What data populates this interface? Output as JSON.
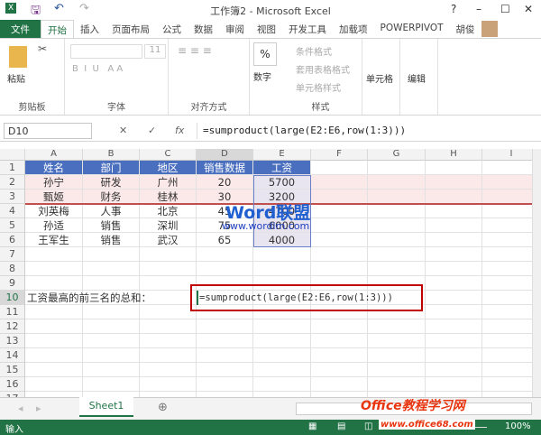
{
  "title": "工作簿2 - Microsoft Excel",
  "user": "胡俊",
  "tabs": [
    "文件",
    "开始",
    "插入",
    "页面布局",
    "公式",
    "数据",
    "审阅",
    "视图",
    "开发工具",
    "加载项",
    "POWERPIVOT"
  ],
  "ribbon": {
    "paste": "粘贴",
    "clipboard": "剪贴板",
    "font_size": "11",
    "font": "字体",
    "align": "对齐方式",
    "number": "数字",
    "cond": "条件格式",
    "table": "套用表格格式",
    "cellstyle": "单元格样式",
    "styles": "样式",
    "cells": "单元格",
    "edit": "编辑"
  },
  "namebox": "D10",
  "fx": "fx",
  "formula": "=sumproduct(large(E2:E6,row(1:3)))",
  "columns": [
    "A",
    "B",
    "C",
    "D",
    "E",
    "F",
    "G",
    "H",
    "I"
  ],
  "rows": [
    "1",
    "2",
    "3",
    "4",
    "5",
    "6",
    "7",
    "8",
    "9",
    "10",
    "11",
    "12",
    "13",
    "14",
    "15",
    "16",
    "17"
  ],
  "table": [
    [
      "姓名",
      "部门",
      "地区",
      "销售数据",
      "工资"
    ],
    [
      "孙宁",
      "研发",
      "广州",
      "20",
      "5700"
    ],
    [
      "甄姬",
      "财务",
      "桂林",
      "30",
      "3200"
    ],
    [
      "刘英梅",
      "人事",
      "北京",
      "45",
      "4700"
    ],
    [
      "孙适",
      "销售",
      "深圳",
      "75",
      "6000"
    ],
    [
      "王军生",
      "销售",
      "武汉",
      "65",
      "4000"
    ]
  ],
  "label10": "工资最高的前三名的总和：",
  "cell10": "=sumproduct(large(E2:E6,row(1:3)))",
  "watermark1": "Word联盟",
  "watermark1_url": "www.wordlm.com",
  "watermark2": "Office教程学习网",
  "watermark2_url": "www.office68.com",
  "sheet": "Sheet1",
  "status": "输入",
  "zoom": "100%"
}
